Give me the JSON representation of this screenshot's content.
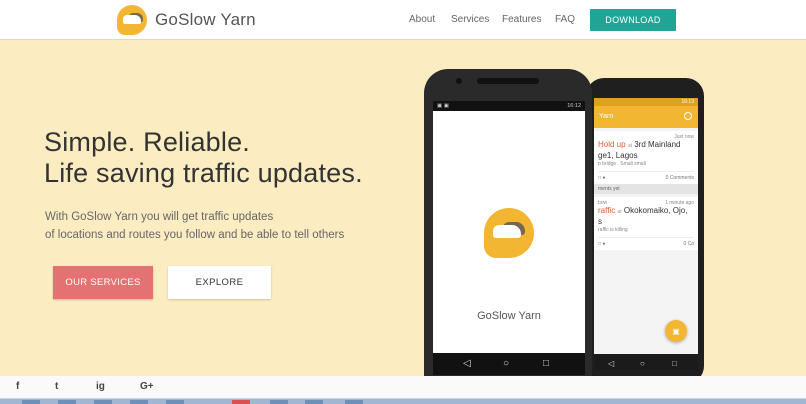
{
  "brand": {
    "name": "GoSlow Yarn",
    "logo_icon": "goslow-logo-icon",
    "color": "#f2b632"
  },
  "nav": {
    "links": [
      "About",
      "Services",
      "Features",
      "FAQ"
    ],
    "download_label": "DOWNLOAD",
    "download_color": "#1fa596"
  },
  "hero": {
    "headline_line1": "Simple. Reliable.",
    "headline_line2": "Life saving traffic updates.",
    "sub_line1": "With GoSlow Yarn you will get traffic updates",
    "sub_line2": "of locations and routes you follow and be able to tell others",
    "services_label": "OUR SERVICES",
    "explore_label": "EXPLORE",
    "background": "#fcecc1",
    "services_color": "#e57272"
  },
  "social": [
    "f",
    "t",
    "ig",
    "G+"
  ],
  "front_phone": {
    "status_time": "16:12",
    "app_name": "GoSlow Yarn"
  },
  "back_phone": {
    "status_time": "16:13",
    "appbar_title": "Yarn",
    "card1": {
      "time": "Just now",
      "title_red": "Hold up",
      "title_grey": "at",
      "title_rest": "3rd Mainland",
      "title_line2": "ge1, Lagos",
      "detail": "p bridge . Small small",
      "comments": "0 Comments"
    },
    "strip": "ments yet",
    "card2": {
      "user": "bow",
      "time": "1 minute ago",
      "title_red": "raffic",
      "title_grey": "at",
      "title_rest": "Okokomaiko, Ojo,",
      "title_line2": "s",
      "detail": "raffic is killing",
      "comments": "0 Co"
    }
  }
}
